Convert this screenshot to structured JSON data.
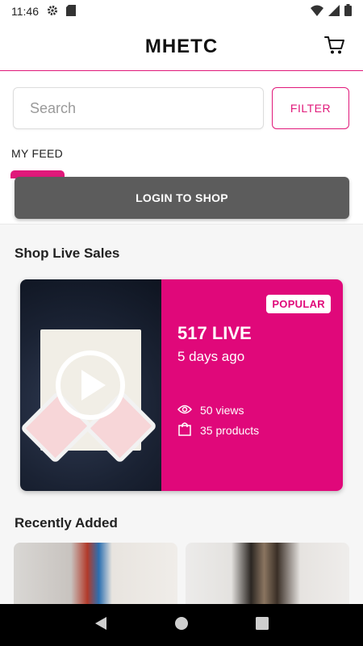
{
  "status_bar": {
    "time": "11:46",
    "icons": [
      "gear-icon",
      "sd-card-icon",
      "wifi-icon",
      "signal-icon",
      "battery-icon"
    ]
  },
  "header": {
    "title": "MHETC",
    "cart_icon": "shopping-cart-icon"
  },
  "search": {
    "placeholder": "Search",
    "filter_label": "FILTER"
  },
  "tabs": {
    "feed_label": "MY FEED"
  },
  "login": {
    "label": "LOGIN TO SHOP"
  },
  "live_sales": {
    "section_title": "Shop Live Sales",
    "card": {
      "badge": "POPULAR",
      "live_title": "517 LIVE",
      "age": "5 days ago",
      "views": "50 views",
      "products": "35 products",
      "play_icon": "play-icon"
    }
  },
  "recently_added": {
    "section_title": "Recently Added"
  },
  "colors": {
    "accent": "#e0197a",
    "card_pink": "#e0087a",
    "login_gray": "#5c5c5c"
  }
}
